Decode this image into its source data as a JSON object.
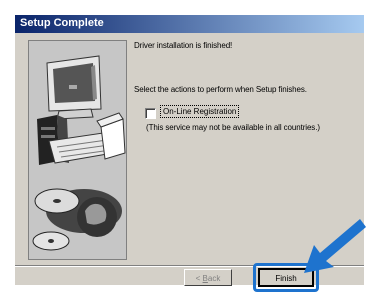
{
  "dialog": {
    "title": "Setup Complete",
    "message": "Driver installation is finished!",
    "instruction": "Select the actions to perform when Setup finishes.",
    "checkbox_label": "On-Line Registration",
    "checkbox_checked": false,
    "note": "(This service may not be available in all countries.)",
    "back_label_prefix": "< ",
    "back_label_key": "B",
    "back_label_rest": "ack",
    "finish_label": "Finish"
  },
  "annotation": {
    "highlight_color": "#1e73ce",
    "arrow_icon": "pointer-arrow-icon"
  }
}
